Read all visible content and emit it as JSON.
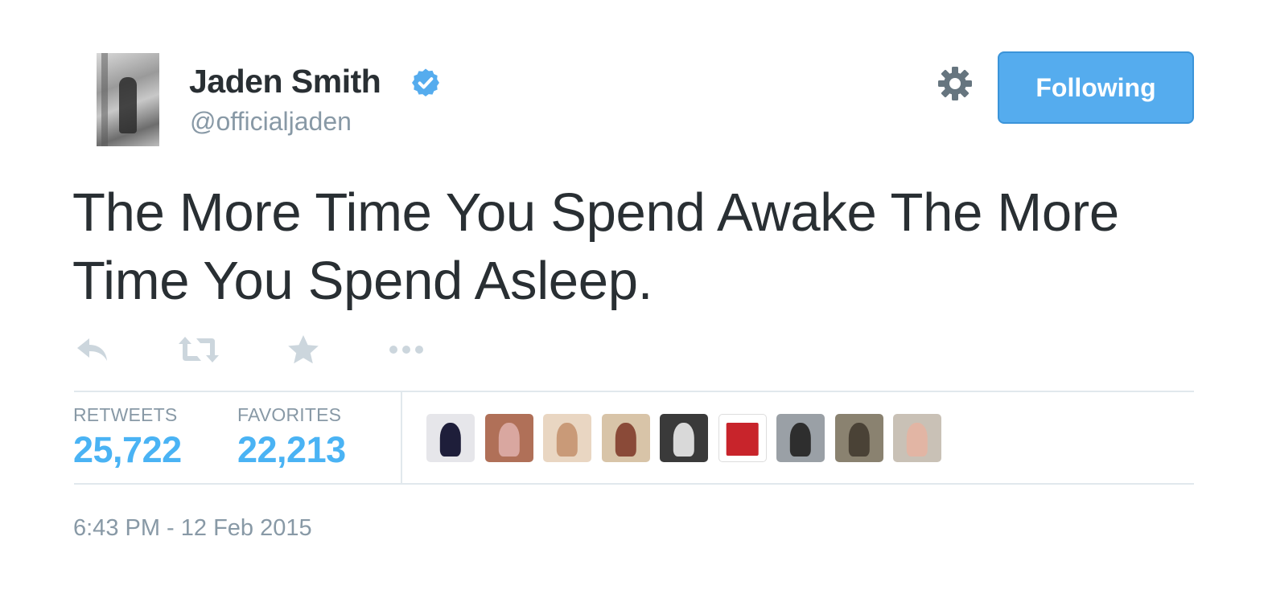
{
  "user": {
    "name": "Jaden Smith",
    "handle": "@officialjaden",
    "verified": true
  },
  "follow_button": {
    "label": "Following"
  },
  "tweet": {
    "text": "The More Time You Spend Awake The More Time You Spend Asleep.",
    "timestamp": "6:43 PM - 12 Feb 2015"
  },
  "actions": [
    {
      "name": "reply-icon"
    },
    {
      "name": "retweet-icon"
    },
    {
      "name": "favorite-icon"
    },
    {
      "name": "more-icon"
    }
  ],
  "stats": {
    "retweets_label": "RETWEETS",
    "retweets_value": "25,722",
    "favorites_label": "FAVORITES",
    "favorites_value": "22,213"
  },
  "colors": {
    "accent": "#55acee",
    "stat_value": "#4ab3f4",
    "muted": "#8899a6",
    "text": "#292f33",
    "verified": "#55acee"
  }
}
